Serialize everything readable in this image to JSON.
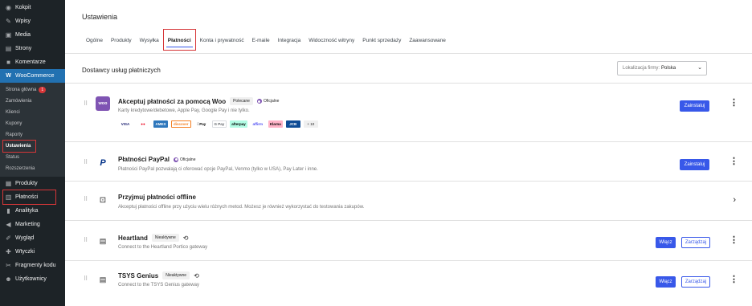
{
  "sidebar": {
    "items_top": [
      {
        "label": "Kokpit",
        "icon": "dashboard-icon",
        "glyph": "◉"
      },
      {
        "label": "Wpisy",
        "icon": "pin-icon",
        "glyph": "✎"
      },
      {
        "label": "Media",
        "icon": "media-icon",
        "glyph": "▣"
      },
      {
        "label": "Strony",
        "icon": "pages-icon",
        "glyph": "▤"
      },
      {
        "label": "Komentarze",
        "icon": "comments-icon",
        "glyph": "■"
      }
    ],
    "woo": {
      "label": "WooCommerce",
      "glyph": "W"
    },
    "submenu": [
      {
        "label": "Strona główna",
        "badge": "1"
      },
      {
        "label": "Zamówienia"
      },
      {
        "label": "Klienci"
      },
      {
        "label": "Kupony"
      },
      {
        "label": "Raporty"
      },
      {
        "label": "Ustawienia",
        "current": true
      },
      {
        "label": "Status"
      },
      {
        "label": "Rozszerzenia"
      }
    ],
    "items_bottom": [
      {
        "label": "Produkty",
        "icon": "products-icon",
        "glyph": "▦"
      },
      {
        "label": "Płatności",
        "icon": "payments-icon",
        "glyph": "▥"
      },
      {
        "label": "Analityka",
        "icon": "analytics-icon",
        "glyph": "▮"
      },
      {
        "label": "Marketing",
        "icon": "marketing-icon",
        "glyph": "◀"
      },
      {
        "label": "Wygląd",
        "icon": "appearance-icon",
        "glyph": "✐"
      },
      {
        "label": "Wtyczki",
        "icon": "plugins-icon",
        "glyph": "✚"
      },
      {
        "label": "Fragmenty kodu",
        "icon": "code-snippets-icon",
        "glyph": "✂"
      },
      {
        "label": "Użytkownicy",
        "icon": "users-icon",
        "glyph": "☻"
      }
    ]
  },
  "page": {
    "title": "Ustawienia"
  },
  "tabs": [
    "Ogólne",
    "Produkty",
    "Wysyłka",
    "Płatności",
    "Konta i prywatność",
    "E-maile",
    "Integracja",
    "Widoczność witryny",
    "Punkt sprzedaży",
    "Zaawansowane"
  ],
  "section": {
    "title": "Dostawcy usług płatniczych",
    "location_label": "Lokalizacja firmy:",
    "location_value": "Polska"
  },
  "providers": {
    "woo": {
      "name": "Akceptuj płatności za pomocą Woo",
      "pill": "Polecane",
      "official": "Oficjalne",
      "desc": "Karty kredytowe/debetowe, Apple Pay, Google Pay i nie tylko.",
      "logos": [
        "VISA",
        "MC",
        "AMEX",
        "discover",
        "Pay",
        "G Pay",
        "afterpay",
        "affirm",
        "Klarna",
        "JCB"
      ],
      "more": "+ 10",
      "button": "Zainstaluj"
    },
    "paypal": {
      "name": "Płatności PayPal",
      "official": "Oficjalne",
      "desc": "Płatności PayPal pozwalają ci oferować opcje PayPal, Venmo (tylko w USA), Pay Later i inne.",
      "button": "Zainstaluj"
    },
    "offline": {
      "name": "Przyjmuj płatności offline",
      "desc": "Akceptuj płatności offline przy użyciu wielu różnych metod. Możesz je również wykorzystać do testowania zakupów."
    },
    "heartland": {
      "name": "Heartland",
      "pill": "Nieaktywne",
      "desc": "Connect to the Heartland Portico gateway",
      "enable": "Włącz",
      "manage": "Zarządzaj"
    },
    "tsys": {
      "name": "TSYS Genius",
      "pill": "Nieaktywne",
      "desc": "Connect to the TSYS Genius gateway",
      "enable": "Włącz",
      "manage": "Zarządzaj"
    }
  }
}
